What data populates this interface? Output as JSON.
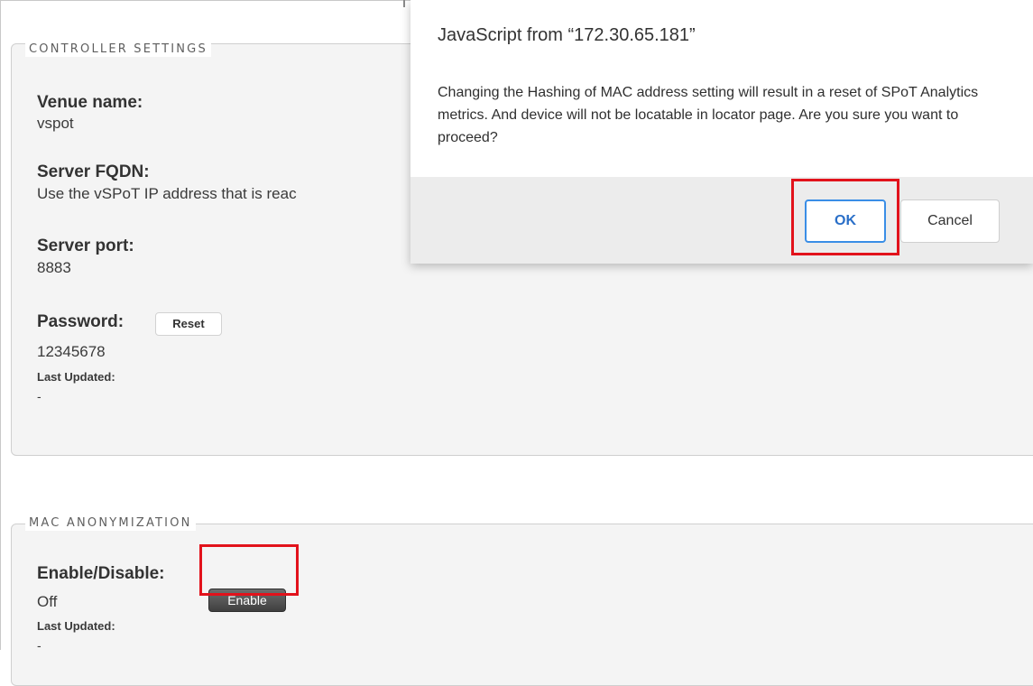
{
  "controller_settings": {
    "legend": "CONTROLLER SETTINGS",
    "venue_name_label": "Venue name:",
    "venue_name_value": "vspot",
    "server_fqdn_label": "Server FQDN:",
    "server_fqdn_value": "Use the vSPoT IP address that is reac",
    "server_port_label": "Server port:",
    "server_port_value": "8883",
    "password_label": "Password:",
    "reset_button_label": "Reset",
    "password_value": "12345678",
    "last_updated_label": "Last Updated:",
    "last_updated_value": "-"
  },
  "mac_anonymization": {
    "legend": "MAC ANONYMIZATION",
    "enable_disable_label": "Enable/Disable:",
    "enable_button_label": "Enable",
    "status_value": "Off",
    "last_updated_label": "Last Updated:",
    "last_updated_value": "-"
  },
  "dialog": {
    "title": "JavaScript from “172.30.65.181”",
    "message": "Changing the Hashing of MAC address setting will result in a reset of SPoT Analytics metrics. And device will not be locatable in locator page. Are you sure you want to proceed?",
    "ok_label": "OK",
    "cancel_label": "Cancel"
  },
  "colors": {
    "highlight": "#e2121b",
    "ok_border": "#3a8ee6",
    "panel_background": "#f4f4f4"
  }
}
